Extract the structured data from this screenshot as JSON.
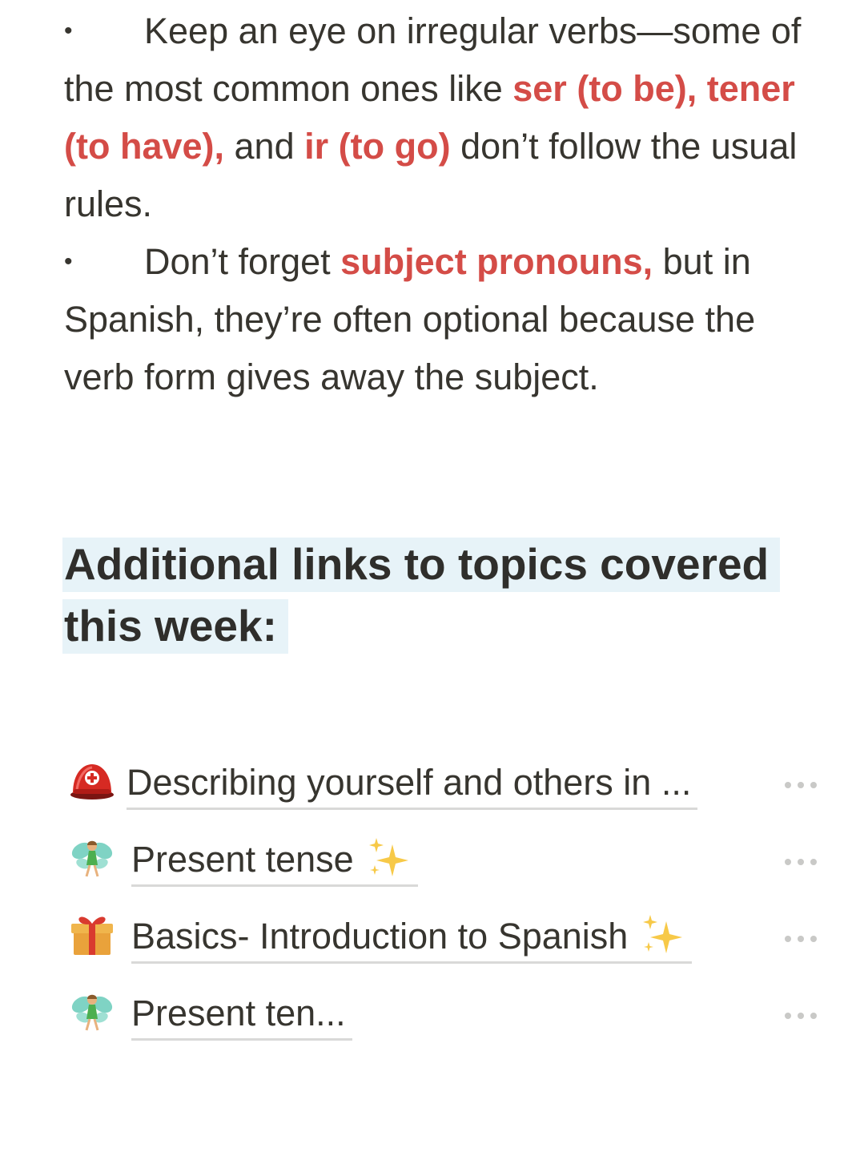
{
  "bullets": [
    {
      "dot": "•",
      "parts": [
        {
          "text": "Keep an eye on irregular verbs—some of the most common ones like ",
          "hl": false
        },
        {
          "text": "ser (to be), tener (to have),",
          "hl": true
        },
        {
          "text": " and ",
          "hl": false
        },
        {
          "text": "ir (to go)",
          "hl": true
        },
        {
          "text": " don’t follow the usual rules.",
          "hl": false
        }
      ]
    },
    {
      "dot": "•",
      "parts": [
        {
          "text": "Don’t forget ",
          "hl": false
        },
        {
          "text": "subject pronouns,",
          "hl": true
        },
        {
          "text": " but in Spanish, they’re often optional because the verb form gives away the subject.",
          "hl": false
        }
      ]
    }
  ],
  "heading": {
    "text": "Additional links to topics covered this week:"
  },
  "links": [
    {
      "title": "Describing yourself and others in ...",
      "icon": "rescue-helmet-icon",
      "sparkle": false
    },
    {
      "title": "Present tense",
      "icon": "fairy-icon",
      "sparkle": true
    },
    {
      "title": "Basics- Introduction to Spanish",
      "icon": "gift-icon",
      "sparkle": true
    },
    {
      "title": "Present ten...",
      "icon": "fairy-icon",
      "sparkle": false
    }
  ],
  "colors": {
    "highlight_text": "#d44c47",
    "heading_background": "#e7f3f8",
    "body_text": "#37352f"
  }
}
